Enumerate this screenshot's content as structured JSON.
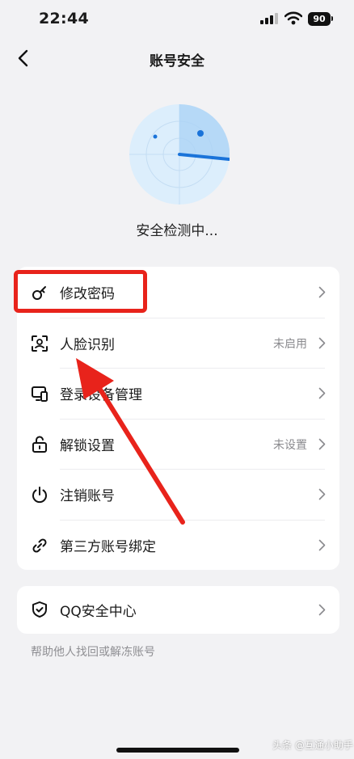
{
  "status_bar": {
    "time": "22:44",
    "battery": "90"
  },
  "nav": {
    "title": "账号安全"
  },
  "scan": {
    "status": "安全检测中..."
  },
  "menu": [
    {
      "label": "修改密码",
      "status": ""
    },
    {
      "label": "人脸识别",
      "status": "未启用"
    },
    {
      "label": "登录设备管理",
      "status": ""
    },
    {
      "label": "解锁设置",
      "status": "未设置"
    },
    {
      "label": "注销账号",
      "status": ""
    },
    {
      "label": "第三方账号绑定",
      "status": ""
    }
  ],
  "security_center": {
    "label": "QQ安全中心"
  },
  "footer": {
    "help_link": "帮助他人找回或解冻账号"
  },
  "watermark": "头条 @互通小助手",
  "colors": {
    "highlight": "#e8231b",
    "radar_fill": "#dceefc",
    "radar_accent": "#1a73d9"
  },
  "icons": [
    "signal-icon",
    "wifi-icon",
    "back-icon",
    "key-icon",
    "face-scan-icon",
    "device-icon",
    "unlock-icon",
    "power-icon",
    "link-icon",
    "shield-icon",
    "chevron-right-icon"
  ]
}
